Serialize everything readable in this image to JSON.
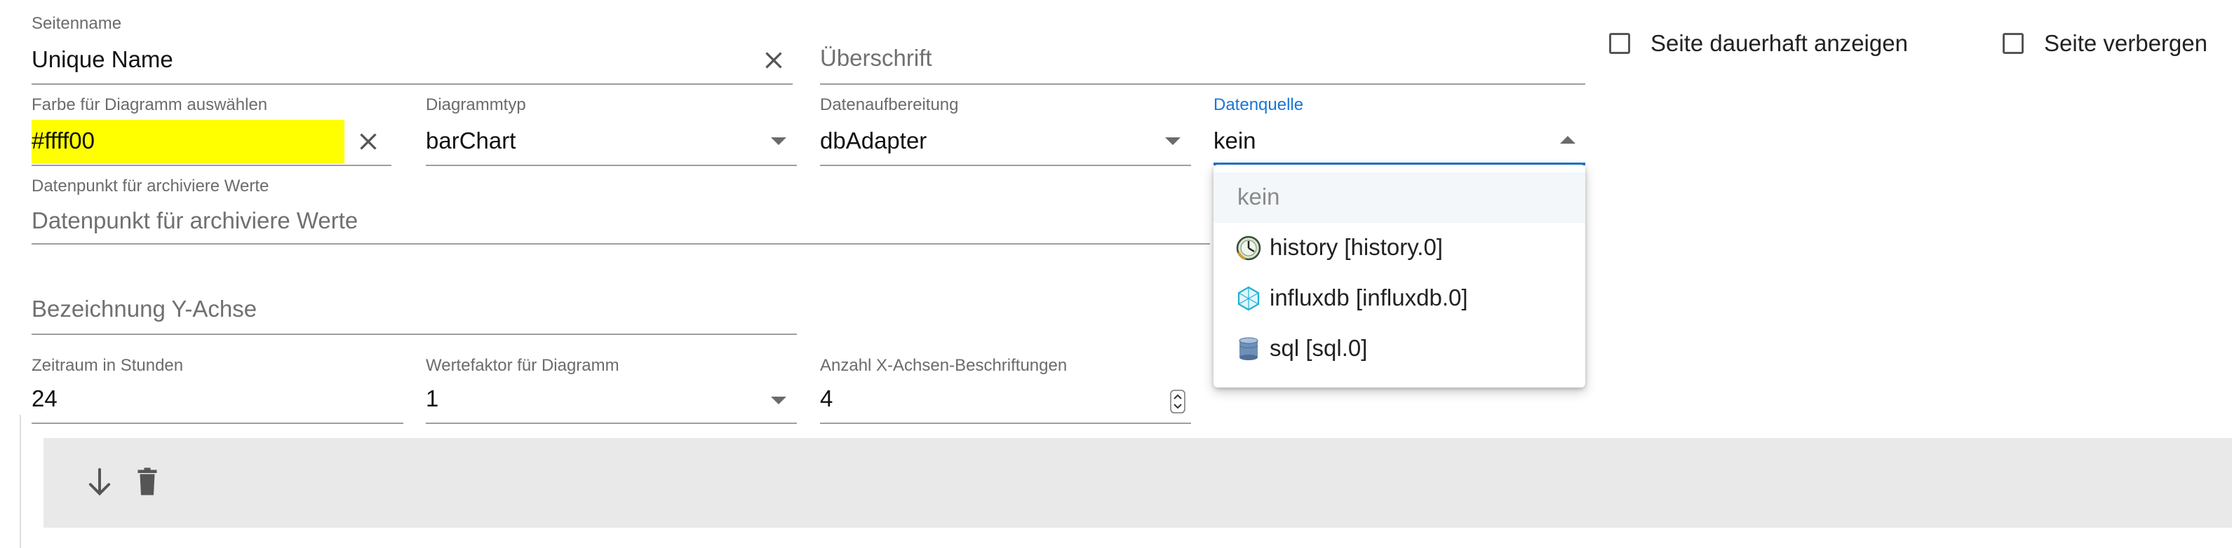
{
  "form": {
    "seitenname": {
      "label": "Seitenname",
      "value": "Unique Name"
    },
    "ueberschrift": {
      "placeholder": "Überschrift"
    },
    "seite_dauerhaft": {
      "label": "Seite dauerhaft anzeigen",
      "checked": false
    },
    "seite_verbergen": {
      "label": "Seite verbergen",
      "checked": false
    },
    "farbe": {
      "label": "Farbe für Diagramm auswählen",
      "value": "#ffff00",
      "swatch_color": "#ffff00"
    },
    "diagrammtyp": {
      "label": "Diagrammtyp",
      "value": "barChart"
    },
    "datenaufbereitung": {
      "label": "Datenaufbereitung",
      "value": "dbAdapter"
    },
    "datenquelle": {
      "label": "Datenquelle",
      "value": "kein",
      "accent_color": "#1976d2"
    },
    "datenpunkt": {
      "label": "Datenpunkt für archiviere Werte",
      "placeholder": "Datenpunkt für archiviere Werte"
    },
    "y_achse": {
      "placeholder": "Bezeichnung Y-Achse"
    },
    "zeitraum": {
      "label": "Zeitraum in Stunden",
      "value": "24"
    },
    "wertefaktor": {
      "label": "Wertefaktor für Diagramm",
      "value": "1"
    },
    "anzahl_x": {
      "label": "Anzahl X-Achsen-Beschriftungen",
      "value": "4"
    }
  },
  "dropdown": {
    "options": [
      {
        "label": "kein",
        "selected": true,
        "icon": "none"
      },
      {
        "label": "history [history.0]",
        "icon": "history-adapter-icon"
      },
      {
        "label": "influxdb [influxdb.0]",
        "icon": "influxdb-adapter-icon"
      },
      {
        "label": "sql [sql.0]",
        "icon": "sql-database-icon"
      }
    ]
  },
  "toolbar": {
    "icons": [
      "arrow-down-icon",
      "trash-icon"
    ],
    "background": "#e9e9e9"
  }
}
